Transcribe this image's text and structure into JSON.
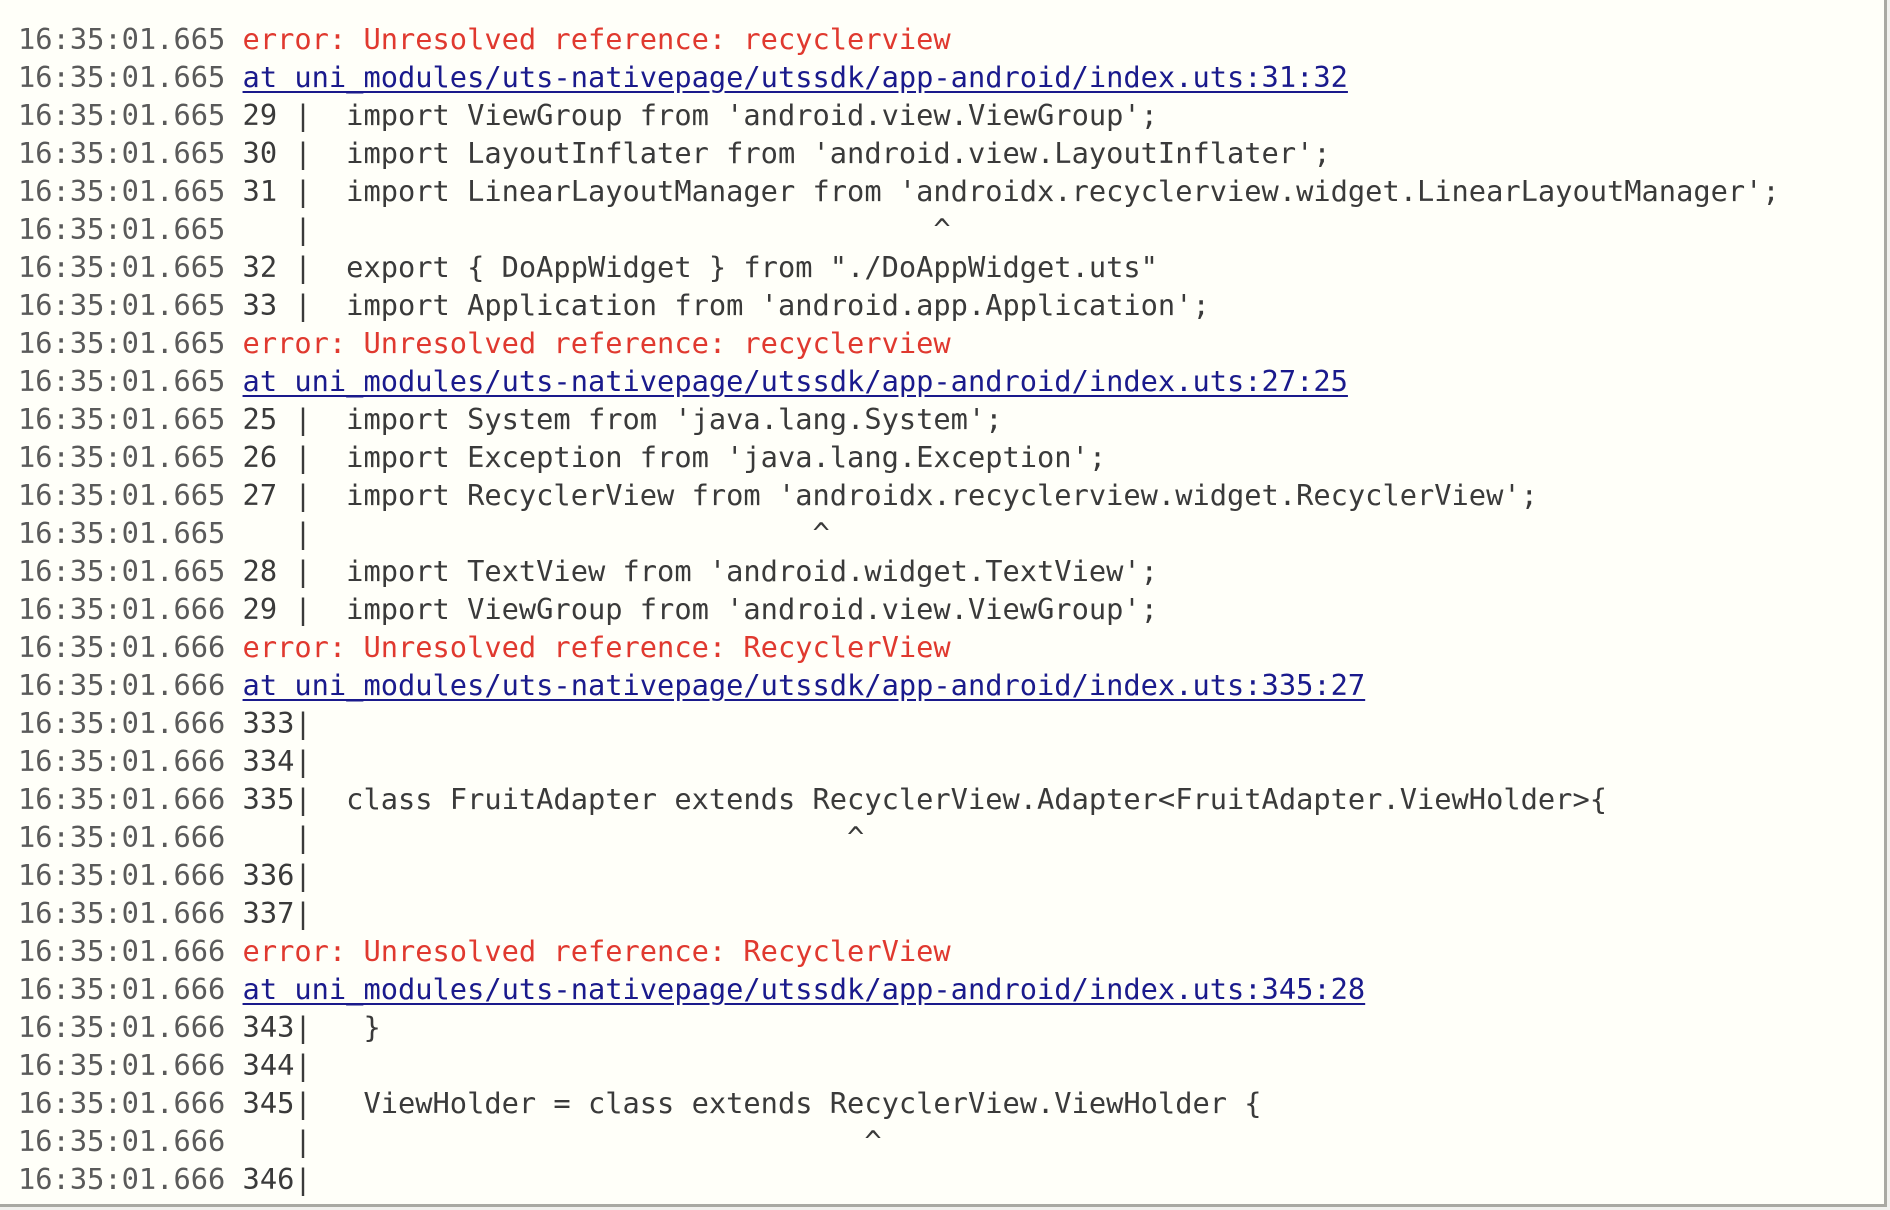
{
  "colors": {
    "error": "#e0392f",
    "link": "#1a1a8c",
    "text": "#3a3a3a",
    "background": "#fffff9"
  },
  "lines": [
    {
      "time": "16:35:01.665",
      "type": "error",
      "text": "error: Unresolved reference: recyclerview"
    },
    {
      "time": "16:35:01.665",
      "type": "link",
      "text": "at uni_modules/uts-nativepage/utssdk/app-android/index.uts:31:32"
    },
    {
      "time": "16:35:01.665",
      "type": "code",
      "text": "29 |  import ViewGroup from 'android.view.ViewGroup';"
    },
    {
      "time": "16:35:01.665",
      "type": "code",
      "text": "30 |  import LayoutInflater from 'android.view.LayoutInflater';"
    },
    {
      "time": "16:35:01.665",
      "type": "code",
      "text": "31 |  import LinearLayoutManager from 'androidx.recyclerview.widget.LinearLayoutManager';"
    },
    {
      "time": "16:35:01.665",
      "type": "code",
      "text": "   |                                    ^"
    },
    {
      "time": "16:35:01.665",
      "type": "code",
      "text": "32 |  export { DoAppWidget } from \"./DoAppWidget.uts\""
    },
    {
      "time": "16:35:01.665",
      "type": "code",
      "text": "33 |  import Application from 'android.app.Application';"
    },
    {
      "time": "16:35:01.665",
      "type": "error",
      "text": "error: Unresolved reference: recyclerview"
    },
    {
      "time": "16:35:01.665",
      "type": "link",
      "text": "at uni_modules/uts-nativepage/utssdk/app-android/index.uts:27:25"
    },
    {
      "time": "16:35:01.665",
      "type": "code",
      "text": "25 |  import System from 'java.lang.System';"
    },
    {
      "time": "16:35:01.665",
      "type": "code",
      "text": "26 |  import Exception from 'java.lang.Exception';"
    },
    {
      "time": "16:35:01.665",
      "type": "code",
      "text": "27 |  import RecyclerView from 'androidx.recyclerview.widget.RecyclerView';"
    },
    {
      "time": "16:35:01.665",
      "type": "code",
      "text": "   |                             ^"
    },
    {
      "time": "16:35:01.665",
      "type": "code",
      "text": "28 |  import TextView from 'android.widget.TextView';"
    },
    {
      "time": "16:35:01.666",
      "type": "code",
      "text": "29 |  import ViewGroup from 'android.view.ViewGroup';"
    },
    {
      "time": "16:35:01.666",
      "type": "error",
      "text": "error: Unresolved reference: RecyclerView"
    },
    {
      "time": "16:35:01.666",
      "type": "link",
      "text": "at uni_modules/uts-nativepage/utssdk/app-android/index.uts:335:27"
    },
    {
      "time": "16:35:01.666",
      "type": "code",
      "text": "333|"
    },
    {
      "time": "16:35:01.666",
      "type": "code",
      "text": "334|"
    },
    {
      "time": "16:35:01.666",
      "type": "code",
      "text": "335|  class FruitAdapter extends RecyclerView.Adapter<FruitAdapter.ViewHolder>{"
    },
    {
      "time": "16:35:01.666",
      "type": "code",
      "text": "   |                               ^"
    },
    {
      "time": "16:35:01.666",
      "type": "code",
      "text": "336|"
    },
    {
      "time": "16:35:01.666",
      "type": "code",
      "text": "337|"
    },
    {
      "time": "16:35:01.666",
      "type": "error",
      "text": "error: Unresolved reference: RecyclerView"
    },
    {
      "time": "16:35:01.666",
      "type": "link",
      "text": "at uni_modules/uts-nativepage/utssdk/app-android/index.uts:345:28"
    },
    {
      "time": "16:35:01.666",
      "type": "code",
      "text": "343|   }"
    },
    {
      "time": "16:35:01.666",
      "type": "code",
      "text": "344|"
    },
    {
      "time": "16:35:01.666",
      "type": "code",
      "text": "345|   ViewHolder = class extends RecyclerView.ViewHolder {"
    },
    {
      "time": "16:35:01.666",
      "type": "code",
      "text": "   |                                ^"
    },
    {
      "time": "16:35:01.666",
      "type": "code",
      "text": "346|"
    }
  ]
}
